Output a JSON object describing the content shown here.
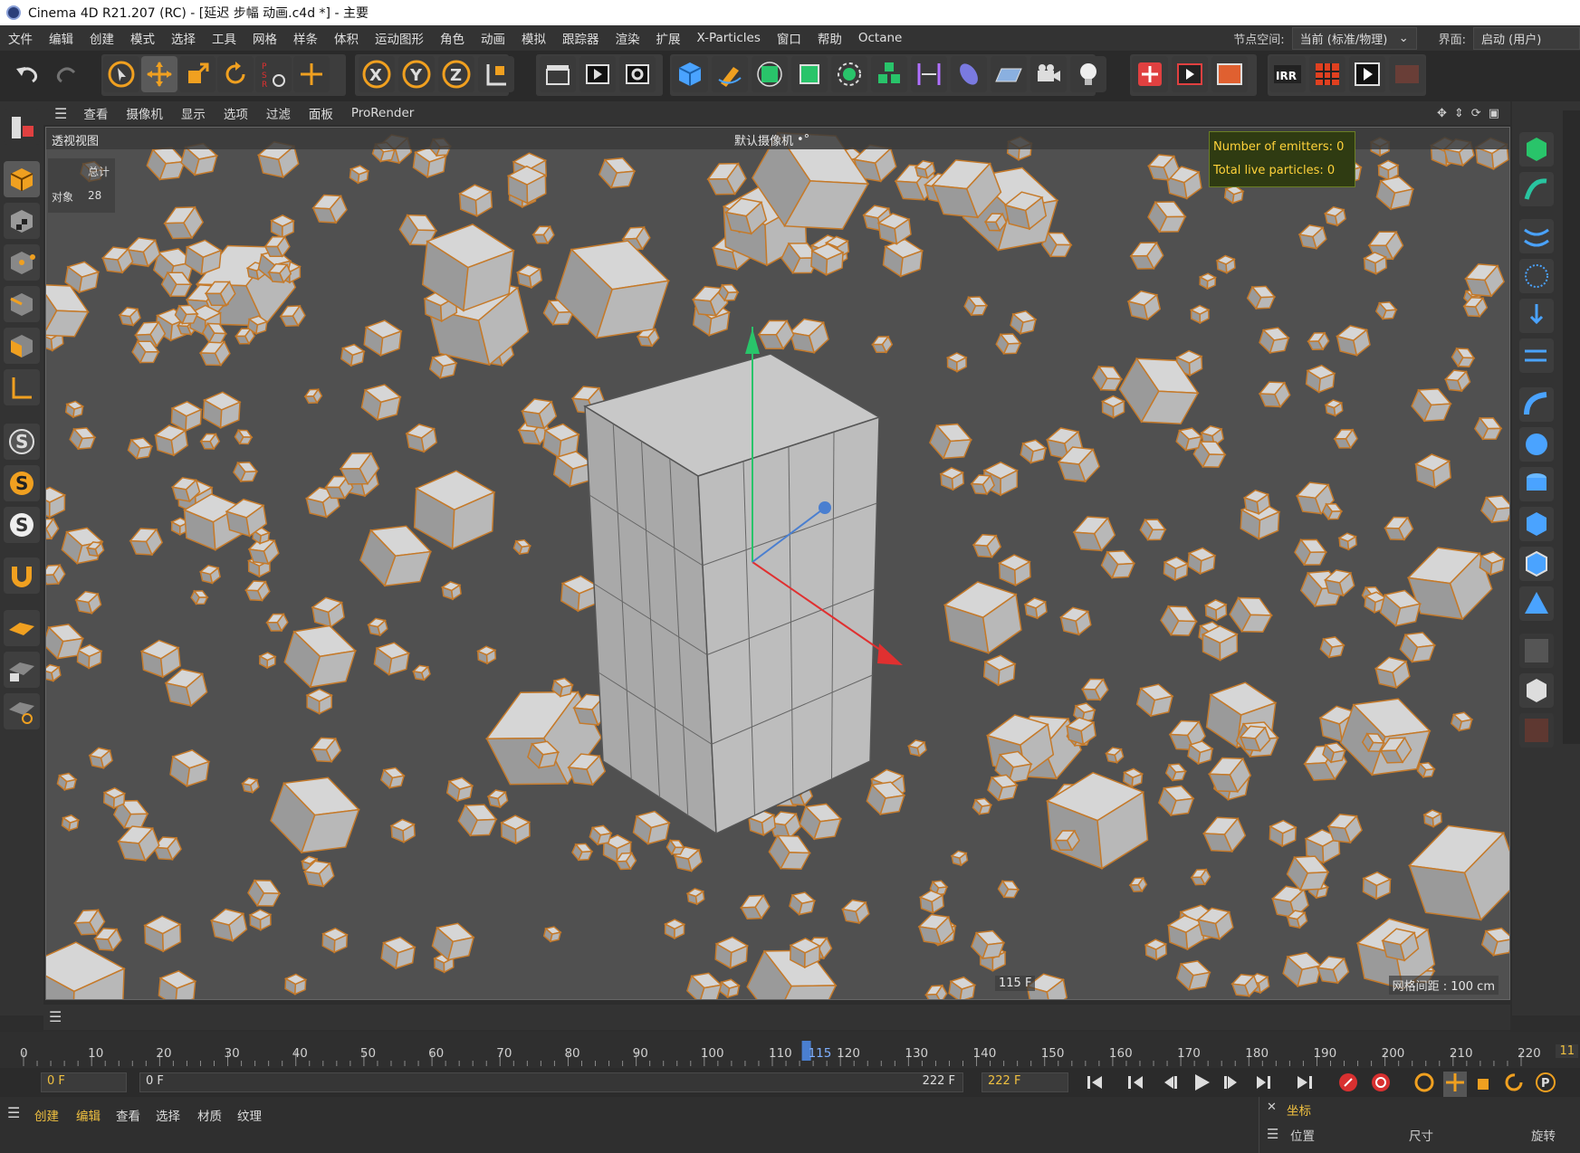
{
  "title_bar": {
    "text": "Cinema 4D R21.207 (RC) - [延迟 步幅 动画.c4d *] - 主要"
  },
  "menu": {
    "items": [
      "文件",
      "编辑",
      "创建",
      "模式",
      "选择",
      "工具",
      "网格",
      "样条",
      "体积",
      "运动图形",
      "角色",
      "动画",
      "模拟",
      "跟踪器",
      "渲染",
      "扩展",
      "X-Particles",
      "窗口",
      "帮助",
      "Octane"
    ],
    "node_space_label": "节点空间:",
    "node_space_value": "当前 (标准/物理)",
    "layout_label": "界面:",
    "layout_value": "启动 (用户)"
  },
  "viewport_menu": {
    "items": [
      "查看",
      "摄像机",
      "显示",
      "选项",
      "过滤",
      "面板",
      "ProRender"
    ]
  },
  "viewport": {
    "view_name": "透视视图",
    "camera_label": "默认摄像机",
    "stats_header": "总计",
    "stats_label": "对象",
    "stats_value": "28",
    "xp_emitters": "Number of emitters: 0",
    "xp_particles": "Total live particles: 0",
    "frame_label": "115 F",
    "grid_label": "网格间距 : 100 cm"
  },
  "timeline": {
    "ticks": [
      "0",
      "10",
      "20",
      "30",
      "40",
      "50",
      "60",
      "70",
      "80",
      "90",
      "100",
      "110",
      "115",
      "120",
      "130",
      "140",
      "150",
      "160",
      "170",
      "180",
      "190",
      "200",
      "210",
      "220"
    ],
    "current_frame": 115,
    "max_frame": 220,
    "right_edge_label": "11"
  },
  "transport": {
    "start_field": "0 F",
    "range_start": "0 F",
    "range_end": "222 F",
    "end_field": "222 F"
  },
  "bottom_bar": {
    "menu": [
      "创建",
      "编辑",
      "查看",
      "选择",
      "材质",
      "纹理"
    ],
    "coords_tab": "坐标",
    "col_position": "位置",
    "col_size": "尺寸",
    "col_rotation": "旋转"
  },
  "colors": {
    "accent": "#f0a020",
    "particle_outline": "#c57a2a",
    "viewport_bg": "#505050"
  }
}
